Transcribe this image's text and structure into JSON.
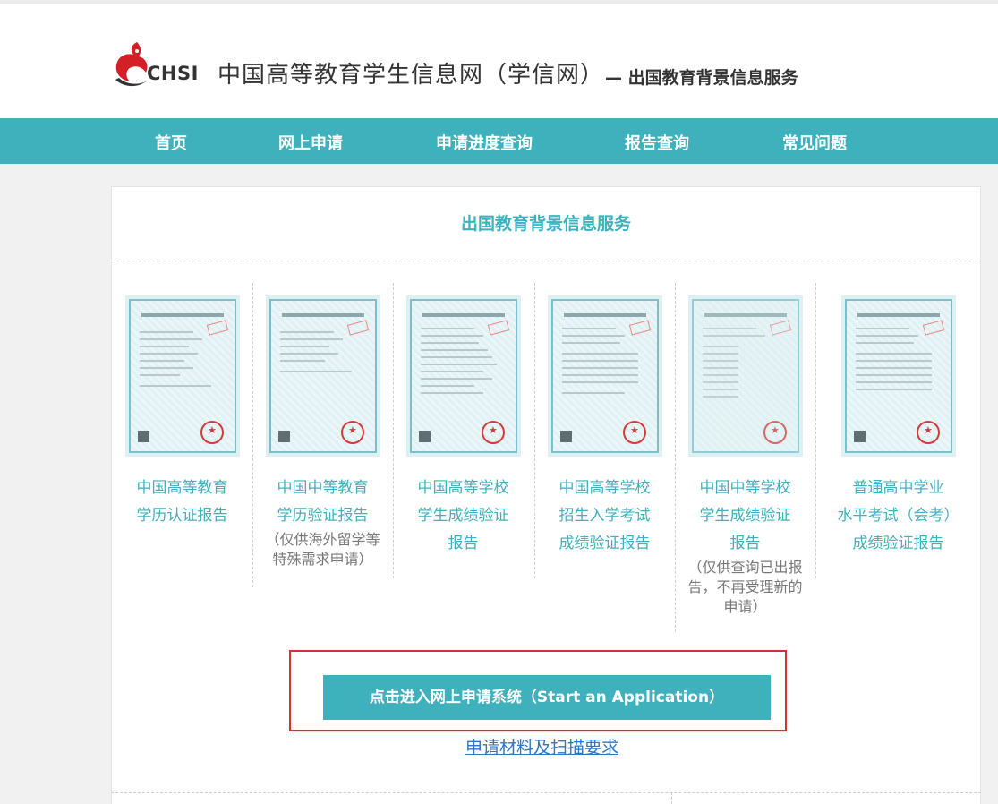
{
  "header": {
    "logo_text": "CHSI",
    "site_title": "中国高等教育学生信息网（学信网）",
    "site_subtitle": "— 出国教育背景信息服务"
  },
  "nav": {
    "items": [
      {
        "label": "首页"
      },
      {
        "label": "网上申请"
      },
      {
        "label": "申请进度查询"
      },
      {
        "label": "报告查询"
      },
      {
        "label": "常见问题"
      }
    ]
  },
  "panel": {
    "title": "出国教育背景信息服务"
  },
  "reports": [
    {
      "line1": "中国高等教育",
      "line2": "学历认证报告",
      "line3": "",
      "note1": "",
      "note2": "",
      "note3": ""
    },
    {
      "line1": "中国中等教育",
      "line2": "学历验证报告",
      "line3": "",
      "note1": "（仅供海外留学等",
      "note2": "特殊需求申请）",
      "note3": ""
    },
    {
      "line1": "中国高等学校",
      "line2": "学生成绩验证",
      "line3": "报告",
      "note1": "",
      "note2": "",
      "note3": ""
    },
    {
      "line1": "中国高等学校",
      "line2": "招生入学考试",
      "line3": "成绩验证报告",
      "note1": "",
      "note2": "",
      "note3": ""
    },
    {
      "line1": "中国中等学校",
      "line2": "学生成绩验证",
      "line3": "报告",
      "note1": "（仅供查询已出报",
      "note2": "告，不再受理新的",
      "note3": "申请）"
    },
    {
      "line1": "普通高中学业",
      "line2": "水平考试（会考）",
      "line3": "成绩验证报告",
      "note1": "",
      "note2": "",
      "note3": ""
    }
  ],
  "cta": {
    "button_label": "点击进入网上申请系统（Start an Application）",
    "link_label": "申请材料及扫描要求"
  },
  "colors": {
    "accent": "#3fb1bc",
    "highlight_border": "#d92e2e",
    "link": "#2a77c9"
  }
}
